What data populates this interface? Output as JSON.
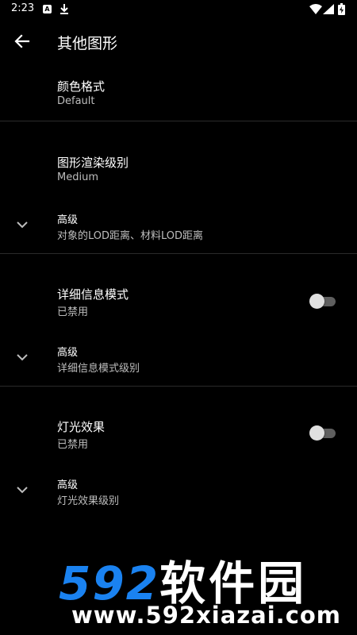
{
  "status": {
    "time": "2:23",
    "a_icon": "A"
  },
  "header": {
    "title": "其他图形"
  },
  "prefs": {
    "color_format": {
      "title": "颜色格式",
      "summary": "Default"
    },
    "render_level": {
      "title": "图形渲染级别",
      "summary": "Medium"
    },
    "adv1": {
      "title": "高级",
      "summary": "对象的LOD距离、材料LOD距离"
    },
    "detail_mode": {
      "title": "详细信息模式",
      "summary": "已禁用",
      "enabled": false
    },
    "adv2": {
      "title": "高级",
      "summary": "详细信息模式级别"
    },
    "light_effect": {
      "title": "灯光效果",
      "summary": "已禁用",
      "enabled": false
    },
    "adv3": {
      "title": "高级",
      "summary": "灯光效果级别"
    }
  },
  "watermark": {
    "brand_num": "592",
    "brand_cn": "软件园",
    "url": "www.592xiazai.com"
  }
}
